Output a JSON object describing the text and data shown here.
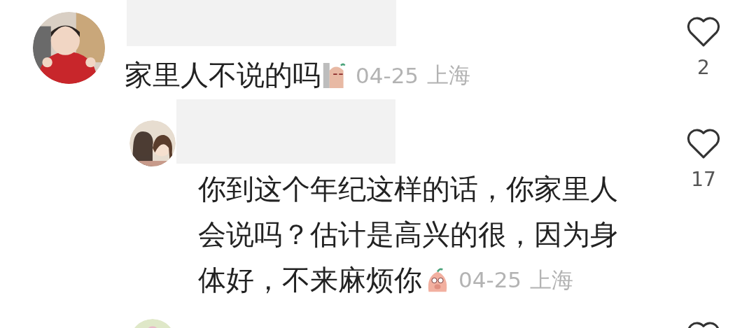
{
  "comments": [
    {
      "text": "家里人不说的吗",
      "date": "04-25",
      "location": "上海",
      "likes": "2",
      "replies": [
        {
          "lines": [
            "你到这个年纪这样的话，你家里人",
            "会说吗？估计是高兴的很，因为身",
            "体好，不来麻烦你"
          ],
          "date": "04-25",
          "location": "上海",
          "likes": "17"
        }
      ]
    }
  ]
}
